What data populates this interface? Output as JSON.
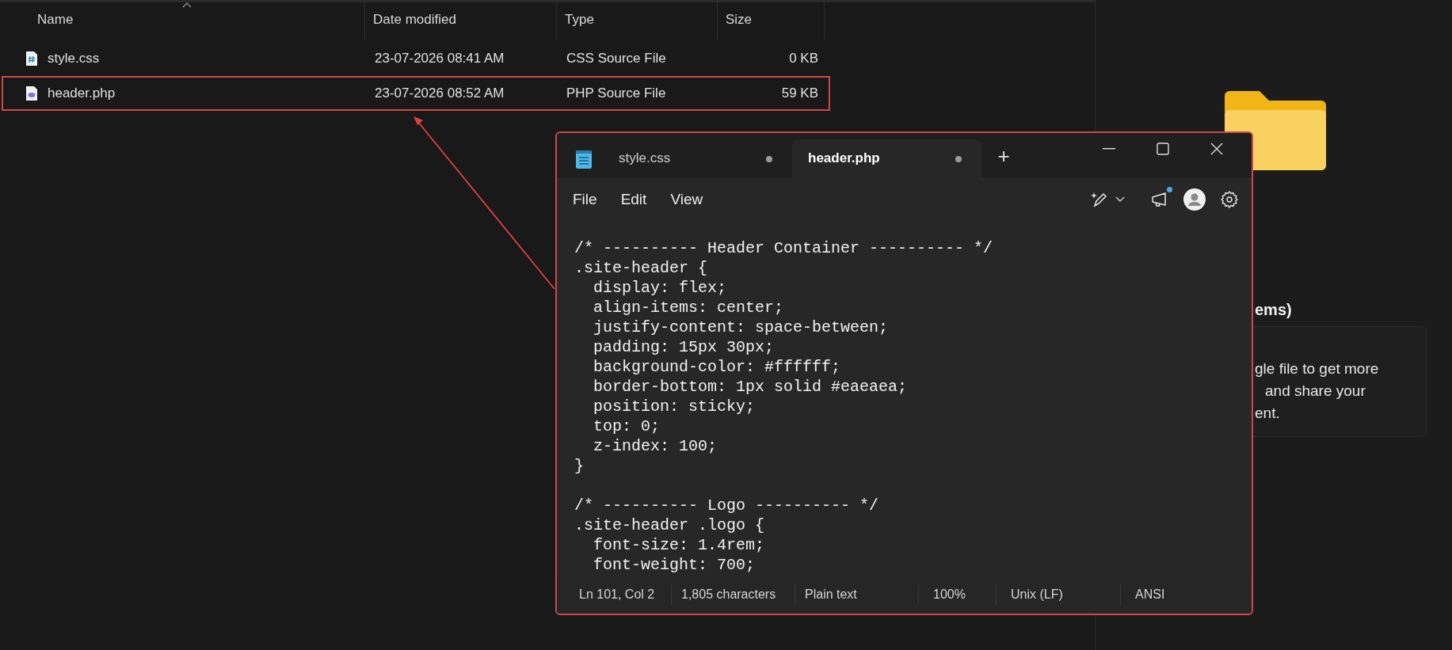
{
  "explorer": {
    "columns": [
      {
        "label": "Name",
        "sorted": true
      },
      {
        "label": "Date modified",
        "sorted": false
      },
      {
        "label": "Type",
        "sorted": false
      },
      {
        "label": "Size",
        "sorted": false
      }
    ],
    "files": [
      {
        "name": "style.css",
        "kind": "css",
        "date": "23-07-2026 08:41 AM",
        "type": "CSS Source File",
        "size": "0 KB",
        "highlighted": false
      },
      {
        "name": "header.php",
        "kind": "php",
        "date": "23-07-2026 08:52 AM",
        "type": "PHP Source File",
        "size": "59 KB",
        "highlighted": true
      }
    ]
  },
  "details_pane": {
    "heading": "ems)",
    "message_lines": [
      "gle file to get more",
      "and share your",
      "ent."
    ]
  },
  "notepad": {
    "tabs": [
      {
        "label": "style.css",
        "selected": false,
        "unsaved": true
      },
      {
        "label": "header.php",
        "selected": true,
        "unsaved": true
      }
    ],
    "add_tab": "+",
    "menu": [
      "File",
      "Edit",
      "View"
    ],
    "notification_badge": true,
    "code_blocks": [
      [
        "/* ---------- Header Container ---------- */",
        ".site-header {",
        "  display: flex;",
        "  align-items: center;",
        "  justify-content: space-between;",
        "  padding: 15px 30px;",
        "  background-color: #ffffff;",
        "  border-bottom: 1px solid #eaeaea;",
        "  position: sticky;",
        "  top: 0;",
        "  z-index: 100;",
        "}"
      ],
      [
        "/* ---------- Logo ---------- */",
        ".site-header .logo {",
        "  font-size: 1.4rem;",
        "  font-weight: 700;"
      ]
    ],
    "status_bar": [
      "Ln 101, Col 2",
      "1,805 characters",
      "Plain text",
      "100%",
      "Unix (LF)",
      "ANSI"
    ]
  }
}
